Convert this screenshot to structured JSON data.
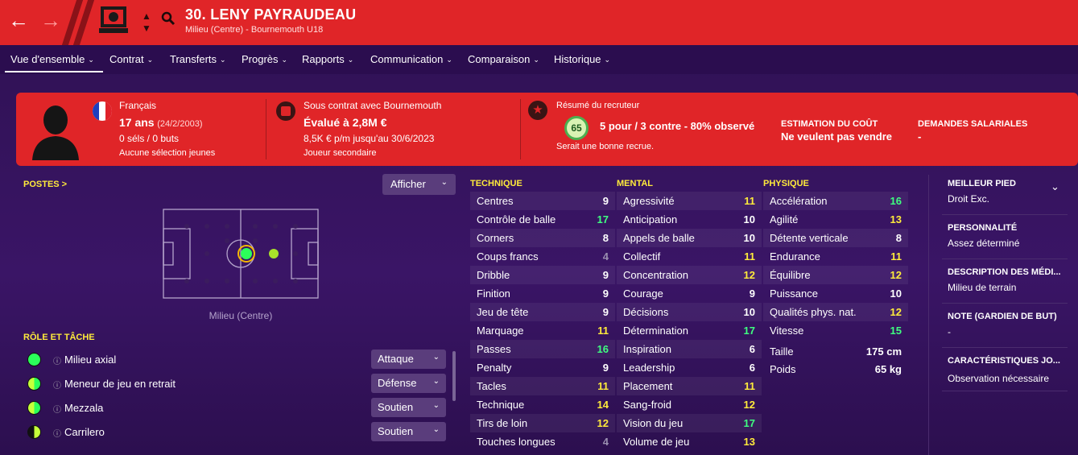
{
  "header": {
    "title": "30. LENY PAYRAUDEAU",
    "subtitle": "Milieu (Centre) - Bournemouth U18",
    "back_icon": "←",
    "fwd_icon": "→"
  },
  "tabs": [
    {
      "label": "Vue d'ensemble"
    },
    {
      "label": "Contrat"
    },
    {
      "label": "Transferts"
    },
    {
      "label": "Progrès"
    },
    {
      "label": "Rapports"
    },
    {
      "label": "Communication"
    },
    {
      "label": "Comparaison"
    },
    {
      "label": "Historique"
    }
  ],
  "bio": {
    "nationality": "Français",
    "age": "17 ans",
    "dob": "(24/2/2003)",
    "caps": "0 séls / 0 buts",
    "youth": "Aucune sélection jeunes"
  },
  "contract": {
    "line1": "Sous contrat avec Bournemouth",
    "value": "Évalué à 2,8M €",
    "wage": "8,5K € p/m jusqu'au 30/6/2023",
    "role": "Joueur secondaire"
  },
  "scout": {
    "title": "Résumé du recruteur",
    "score": "65",
    "summary": "5 pour / 3 contre - 80% observé",
    "verdict": "Serait une bonne recrue."
  },
  "cost": {
    "label": "ESTIMATION DU COÛT",
    "value": "Ne veulent pas vendre"
  },
  "wages": {
    "label": "DEMANDES SALARIALES",
    "value": "-"
  },
  "positions": {
    "title": "POSTES >",
    "button": "Afficher",
    "caption": "Milieu (Centre)"
  },
  "roles": {
    "title": "RÔLE ET TÂCHE",
    "items": [
      {
        "name": "Milieu axial",
        "duty": "Attaque",
        "color": "#2bff5a"
      },
      {
        "name": "Meneur de jeu en retrait",
        "duty": "Défense",
        "color": "#2bff5a"
      },
      {
        "name": "Mezzala",
        "duty": "Soutien",
        "color": "#2bff5a"
      },
      {
        "name": "Carrilero",
        "duty": "Soutien",
        "color": "#c6ff3a"
      }
    ]
  },
  "attributes": {
    "technique": {
      "title": "TECHNIQUE",
      "rows": [
        [
          "Centres",
          "9"
        ],
        [
          "Contrôle de balle",
          "17"
        ],
        [
          "Corners",
          "8"
        ],
        [
          "Coups francs",
          "4"
        ],
        [
          "Dribble",
          "9"
        ],
        [
          "Finition",
          "9"
        ],
        [
          "Jeu de tête",
          "9"
        ],
        [
          "Marquage",
          "11"
        ],
        [
          "Passes",
          "16"
        ],
        [
          "Penalty",
          "9"
        ],
        [
          "Tacles",
          "11"
        ],
        [
          "Technique",
          "14"
        ],
        [
          "Tirs de loin",
          "12"
        ],
        [
          "Touches longues",
          "4"
        ]
      ]
    },
    "mental": {
      "title": "MENTAL",
      "rows": [
        [
          "Agressivité",
          "11"
        ],
        [
          "Anticipation",
          "10"
        ],
        [
          "Appels de balle",
          "10"
        ],
        [
          "Collectif",
          "11"
        ],
        [
          "Concentration",
          "12"
        ],
        [
          "Courage",
          "9"
        ],
        [
          "Décisions",
          "10"
        ],
        [
          "Détermination",
          "17"
        ],
        [
          "Inspiration",
          "6"
        ],
        [
          "Leadership",
          "6"
        ],
        [
          "Placement",
          "11"
        ],
        [
          "Sang-froid",
          "12"
        ],
        [
          "Vision du jeu",
          "17"
        ],
        [
          "Volume de jeu",
          "13"
        ]
      ]
    },
    "physique": {
      "title": "PHYSIQUE",
      "rows": [
        [
          "Accélération",
          "16"
        ],
        [
          "Agilité",
          "13"
        ],
        [
          "Détente verticale",
          "8"
        ],
        [
          "Endurance",
          "11"
        ],
        [
          "Équilibre",
          "12"
        ],
        [
          "Puissance",
          "10"
        ],
        [
          "Qualités phys. nat.",
          "12"
        ],
        [
          "Vitesse",
          "15"
        ]
      ]
    },
    "height": {
      "label": "Taille",
      "value": "175 cm"
    },
    "weight": {
      "label": "Poids",
      "value": "65 kg"
    }
  },
  "side": [
    {
      "label": "MEILLEUR PIED",
      "value": "Droit Exc."
    },
    {
      "label": "PERSONNALITÉ",
      "value": "Assez déterminé"
    },
    {
      "label": "DESCRIPTION DES MÉDI...",
      "value": "Milieu de terrain"
    },
    {
      "label": "NOTE (GARDIEN DE BUT)",
      "value": "-"
    },
    {
      "label": "CARACTÉRISTIQUES JO...",
      "value": "Observation nécessaire"
    }
  ],
  "colors": {
    "header": "#e02528",
    "bg": "#2e1152",
    "high": "#3fff80",
    "mid": "#ffeb3b",
    "low": "#9a8fb0"
  }
}
